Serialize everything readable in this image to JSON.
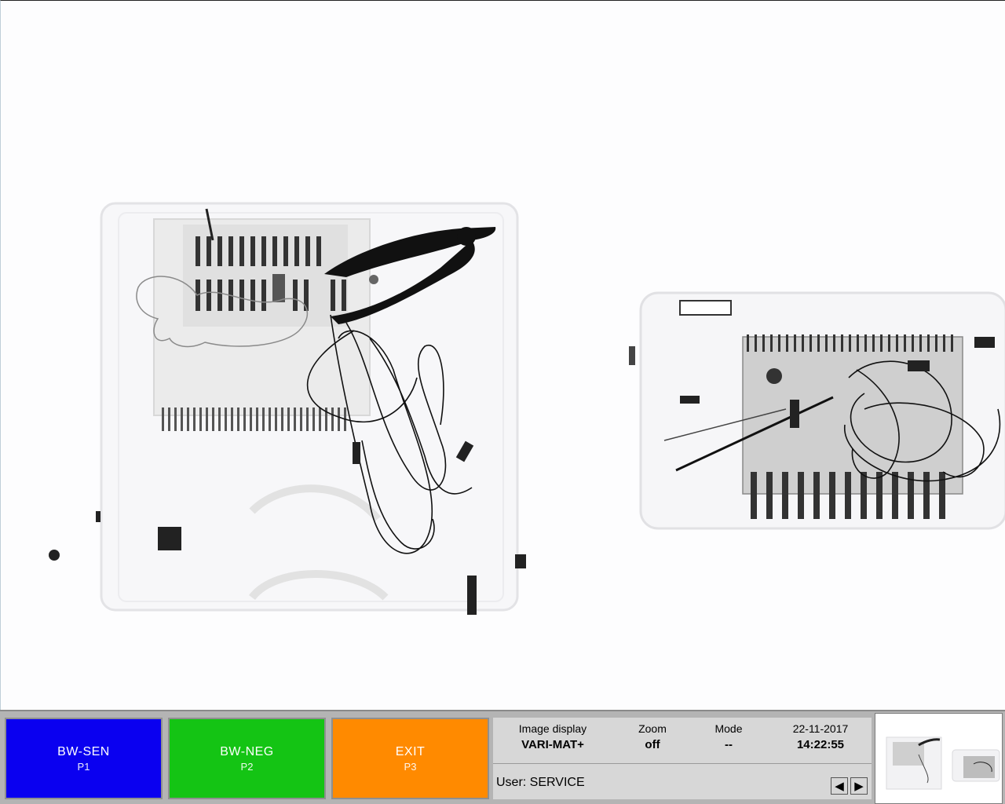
{
  "function_keys": [
    {
      "label": "BW-SEN",
      "sub": "P1",
      "color": "#0a00f0"
    },
    {
      "label": "BW-NEG",
      "sub": "P2",
      "color": "#14c414"
    },
    {
      "label": "EXIT",
      "sub": "P3",
      "color": "#ff8a00"
    }
  ],
  "status": {
    "image_display": {
      "label": "Image display",
      "value": "VARI-MAT+"
    },
    "zoom": {
      "label": "Zoom",
      "value": "off"
    },
    "mode": {
      "label": "Mode",
      "value": "--"
    },
    "date": "22-11-2017",
    "time": "14:22:55"
  },
  "user": "User: SERVICE",
  "navigation": {
    "prev_icon": "arrow-left-icon",
    "next_icon": "arrow-right-icon"
  },
  "scan": {
    "objects": [
      "suitcase-left",
      "suitcase-right",
      "pliers",
      "coiled-cables",
      "circuit-board"
    ]
  }
}
